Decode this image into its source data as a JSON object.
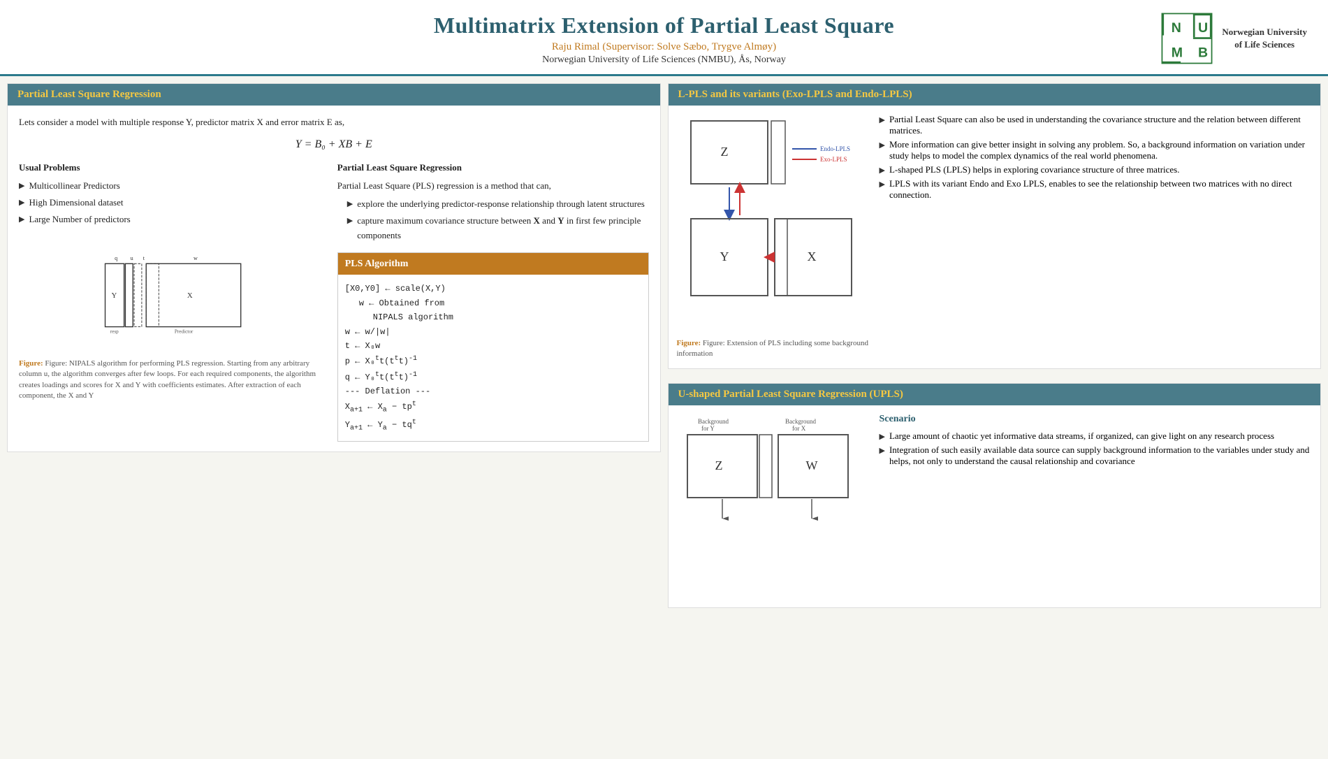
{
  "header": {
    "title": "Multimatrix Extension of Partial Least Square",
    "authors": "Raju Rimal (Supervisor: Solve Sæbo, Trygve Almøy)",
    "institution": "Norwegian University of Life Sciences (NMBU), Ås, Norway",
    "logo_text": "Norwegian University\nof Life Sciences"
  },
  "left_panel": {
    "title": "Partial Least Square Regression",
    "intro": "Lets consider a model with multiple response Y, predictor matrix X and error matrix E as,",
    "formula": "Y = B₀ + XB + E",
    "problems": {
      "title": "Usual Problems",
      "items": [
        "Multicollinear Predictors",
        "High Dimensional dataset",
        "Large Number of predictors"
      ]
    },
    "pls_reg": {
      "title": "Partial Least Square Regression",
      "desc": "Partial Least Square (PLS) regression is a method that can,",
      "items": [
        "explore the underlying predictor-response relationship through latent structures",
        "capture maximum covariance structure between X and Y in first few principle components"
      ]
    },
    "figure_caption": "Figure: NIPALS algorithm for performing PLS regression. Starting from any arbitrary column u, the algorithm converges after few loops. For each required components, the algorithm creates loadings and scores for X and Y with coefficients estimates. After extraction of each component, the X and Y"
  },
  "algorithm": {
    "title": "PLS Algorithm",
    "lines": [
      "[X0, Y0] ← scale(X,Y)",
      "w ← Obtained from",
      "     NIPALS algorithm",
      "w ← w/|w|",
      "t ← X₀w",
      "p ← X₀ᵗt(tᵗt)⁻¹",
      "q ← Y₀ᵗt(tᵗt)⁻¹",
      "--- Deflation ---",
      "X_{a+1} ← X_a − tpᵗ",
      "Y_{a+1} ← Y_a − tqᵗ"
    ]
  },
  "lpls_panel": {
    "title": "L-PLS and its variants (Exo-LPLS and Endo-LPLS)",
    "bullets": [
      "Partial Least Square can also be used in understanding the covariance structure and the relation between different matrices.",
      "More information can give better insight in solving any problem. So, a background information on variation under study helps to model the complex dynamics of the real world phenomena.",
      "L-shaped PLS (LPLS) helps in exploring covariance structure of three matrices.",
      "LPLS with its variant Endo and Exo LPLS, enables to see the relationship between two matrices with no direct connection."
    ],
    "figure_caption": "Figure: Extension of PLS including some background information",
    "endo_label": "Endo-LPLS",
    "exo_label": "Exo-LPLS"
  },
  "upls_panel": {
    "title": "U-shaped Partial Least Square Regression (UPLS)",
    "scenario_title": "Scenario",
    "bullets": [
      "Large amount of chaotic yet informative data streams, if organized, can give light on any research process",
      "Integration of such easily available data source can supply background information to the variables under study and helps, not only to understand the causal relationship and covariance"
    ],
    "labels": {
      "bg_y": "Background for Y",
      "bg_x": "Background for X",
      "z_label": "Z",
      "w_label": "W"
    }
  },
  "colors": {
    "header_blue": "#2c5f6e",
    "panel_header_bg": "#4a7c8a",
    "panel_header_text": "#f5c842",
    "algo_header_bg": "#c07a20",
    "link_orange": "#c07a20",
    "scenario_title": "#2c5f6e"
  }
}
